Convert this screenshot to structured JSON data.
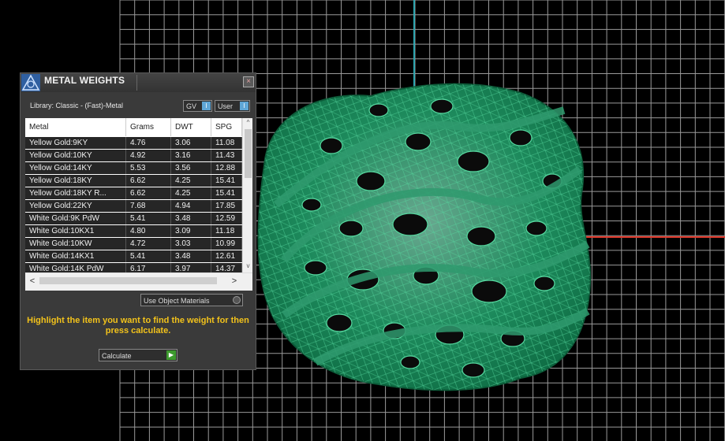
{
  "dialog": {
    "title": "METAL WEIGHTS",
    "close_icon": "×",
    "library_label": "Library: Classic - (Fast)-Metal",
    "toggle_gv": {
      "label": "GV",
      "icon": "I"
    },
    "toggle_user": {
      "label": "User",
      "icon": "I"
    },
    "table": {
      "columns": [
        "Metal",
        "Grams",
        "DWT",
        "SPG"
      ],
      "rows": [
        [
          "Yellow Gold:9KY",
          "4.76",
          "3.06",
          "11.08"
        ],
        [
          "Yellow Gold:10KY",
          "4.92",
          "3.16",
          "11.43"
        ],
        [
          "Yellow Gold:14KY",
          "5.53",
          "3.56",
          "12.88"
        ],
        [
          "Yellow Gold:18KY",
          "6.62",
          "4.25",
          "15.41"
        ],
        [
          "Yellow Gold:18KY R...",
          "6.62",
          "4.25",
          "15.41"
        ],
        [
          "Yellow Gold:22KY",
          "7.68",
          "4.94",
          "17.85"
        ],
        [
          "White Gold:9K PdW",
          "5.41",
          "3.48",
          "12.59"
        ],
        [
          "White Gold:10KX1",
          "4.80",
          "3.09",
          "11.18"
        ],
        [
          "White Gold:10KW",
          "4.72",
          "3.03",
          "10.99"
        ],
        [
          "White Gold:14KX1",
          "5.41",
          "3.48",
          "12.61"
        ],
        [
          "White Gold:14K PdW",
          "6.17",
          "3.97",
          "14.37"
        ]
      ]
    },
    "use_object_materials": "Use Object Materials",
    "instructions": "Highlight the item you want to find the weight for then press calculate.",
    "calculate_label": "Calculate",
    "scroll": {
      "left": "<",
      "right": ">",
      "up": "^",
      "down": "v"
    }
  },
  "viewport": {
    "grid_color": "#9a9a9a",
    "axis_x_color": "#e0392b",
    "axis_y_color": "#2fa6b0",
    "mesh_color": "#1f8a5e",
    "mesh_line_color": "#4fd59a"
  }
}
